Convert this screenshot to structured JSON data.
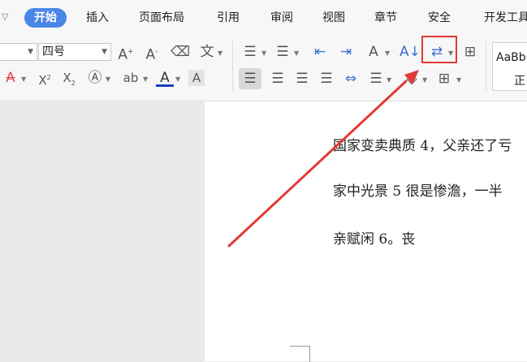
{
  "tabs": [
    {
      "label": "开始",
      "active": true
    },
    {
      "label": "插入"
    },
    {
      "label": "页面布局"
    },
    {
      "label": "引用"
    },
    {
      "label": "审阅"
    },
    {
      "label": "视图"
    },
    {
      "label": "章节"
    },
    {
      "label": "安全"
    },
    {
      "label": "开发工具"
    }
  ],
  "ribbon": {
    "font_size_value": "四号",
    "style_preview_text": "AaBb",
    "style_name": "正"
  },
  "document": {
    "lines": [
      "国家变卖典质 4，父亲还了亏",
      "家中光景 5 很是惨澹，一半",
      "亲赋闲 6。丧"
    ]
  },
  "colors": {
    "accent": "#4a86e8",
    "highlight": "#e53935",
    "font_color_underline": "#1a3fc4"
  },
  "icons": [
    "dropdown-arrow-icon",
    "grow-font-icon",
    "shrink-font-icon",
    "clear-format-icon",
    "phonetic-guide-icon",
    "bullets-icon",
    "numbering-icon",
    "decrease-indent-icon",
    "increase-indent-icon",
    "text-direction-icon",
    "sort-icon",
    "line-break-icon",
    "table-border-icon",
    "strikethrough-icon",
    "superscript-icon",
    "subscript-icon",
    "text-effects-icon",
    "highlight-icon",
    "font-color-icon",
    "char-shading-icon",
    "align-left-icon",
    "align-center-icon",
    "align-right-icon",
    "justify-icon",
    "distributed-icon",
    "line-spacing-icon",
    "shading-icon",
    "borders-icon"
  ]
}
